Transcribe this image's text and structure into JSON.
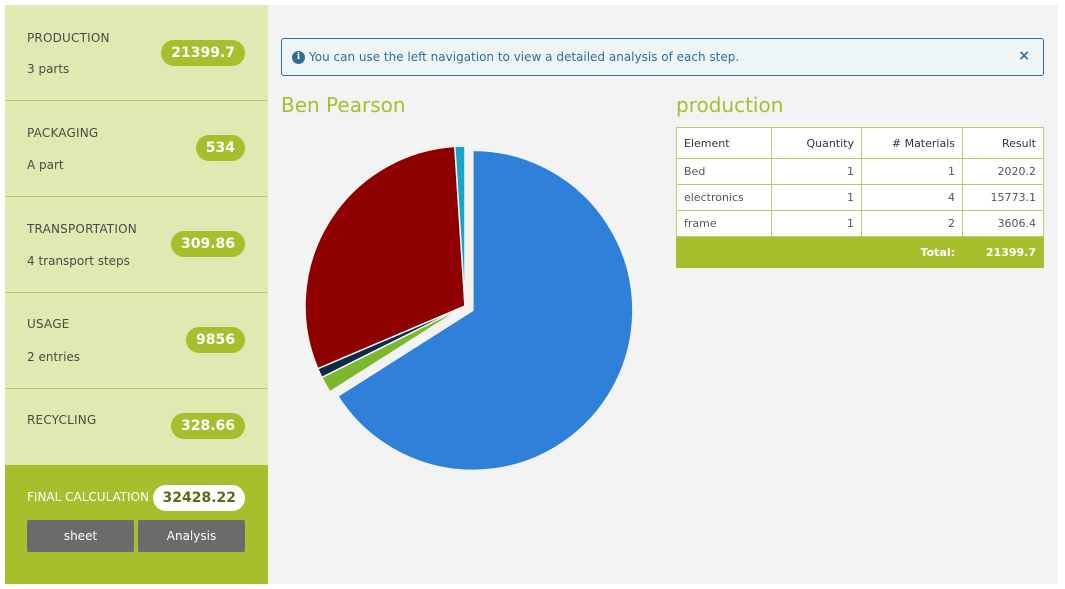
{
  "sidebar": {
    "steps": [
      {
        "title": "PRODUCTION",
        "subtitle": "3 parts",
        "value": "21399.7"
      },
      {
        "title": "PACKAGING",
        "subtitle": "A part",
        "value": "534"
      },
      {
        "title": "TRANSPORTATION",
        "subtitle": "4 transport steps",
        "value": "309.86"
      },
      {
        "title": "USAGE",
        "subtitle": "2 entries",
        "value": "9856"
      },
      {
        "title": "RECYCLING",
        "subtitle": "",
        "value": "328.66"
      }
    ],
    "final": {
      "title": "FINAL CALCULATION",
      "value": "32428.22",
      "sheet_label": "sheet",
      "analysis_label": "Analysis"
    }
  },
  "alert": {
    "icon": "info-icon",
    "text": "You can use the left navigation to view a detailed analysis of each step.",
    "close": "×"
  },
  "chart_title": "Ben Pearson",
  "table": {
    "title": "production",
    "headers": [
      "Element",
      "Quantity",
      "# Materials",
      "Result"
    ],
    "rows": [
      [
        "Bed",
        "1",
        "1",
        "2020.2"
      ],
      [
        "electronics",
        "1",
        "4",
        "15773.1"
      ],
      [
        "frame",
        "1",
        "2",
        "3606.4"
      ]
    ],
    "total_label": "Total:",
    "total_value": "21399.7"
  },
  "colors": {
    "accent": "#a6c02d",
    "sidebar_bg": "#dfe9b2",
    "info": "#2f6f96"
  },
  "chart_data": {
    "type": "pie",
    "title": "Ben Pearson",
    "values": [
      21399.7,
      534,
      309.86,
      9856,
      328.66
    ],
    "colors": [
      "#2e80d8",
      "#7cb82f",
      "#0f2a44",
      "#8e0000",
      "#17a6c8"
    ],
    "exploded_index": 0
  }
}
